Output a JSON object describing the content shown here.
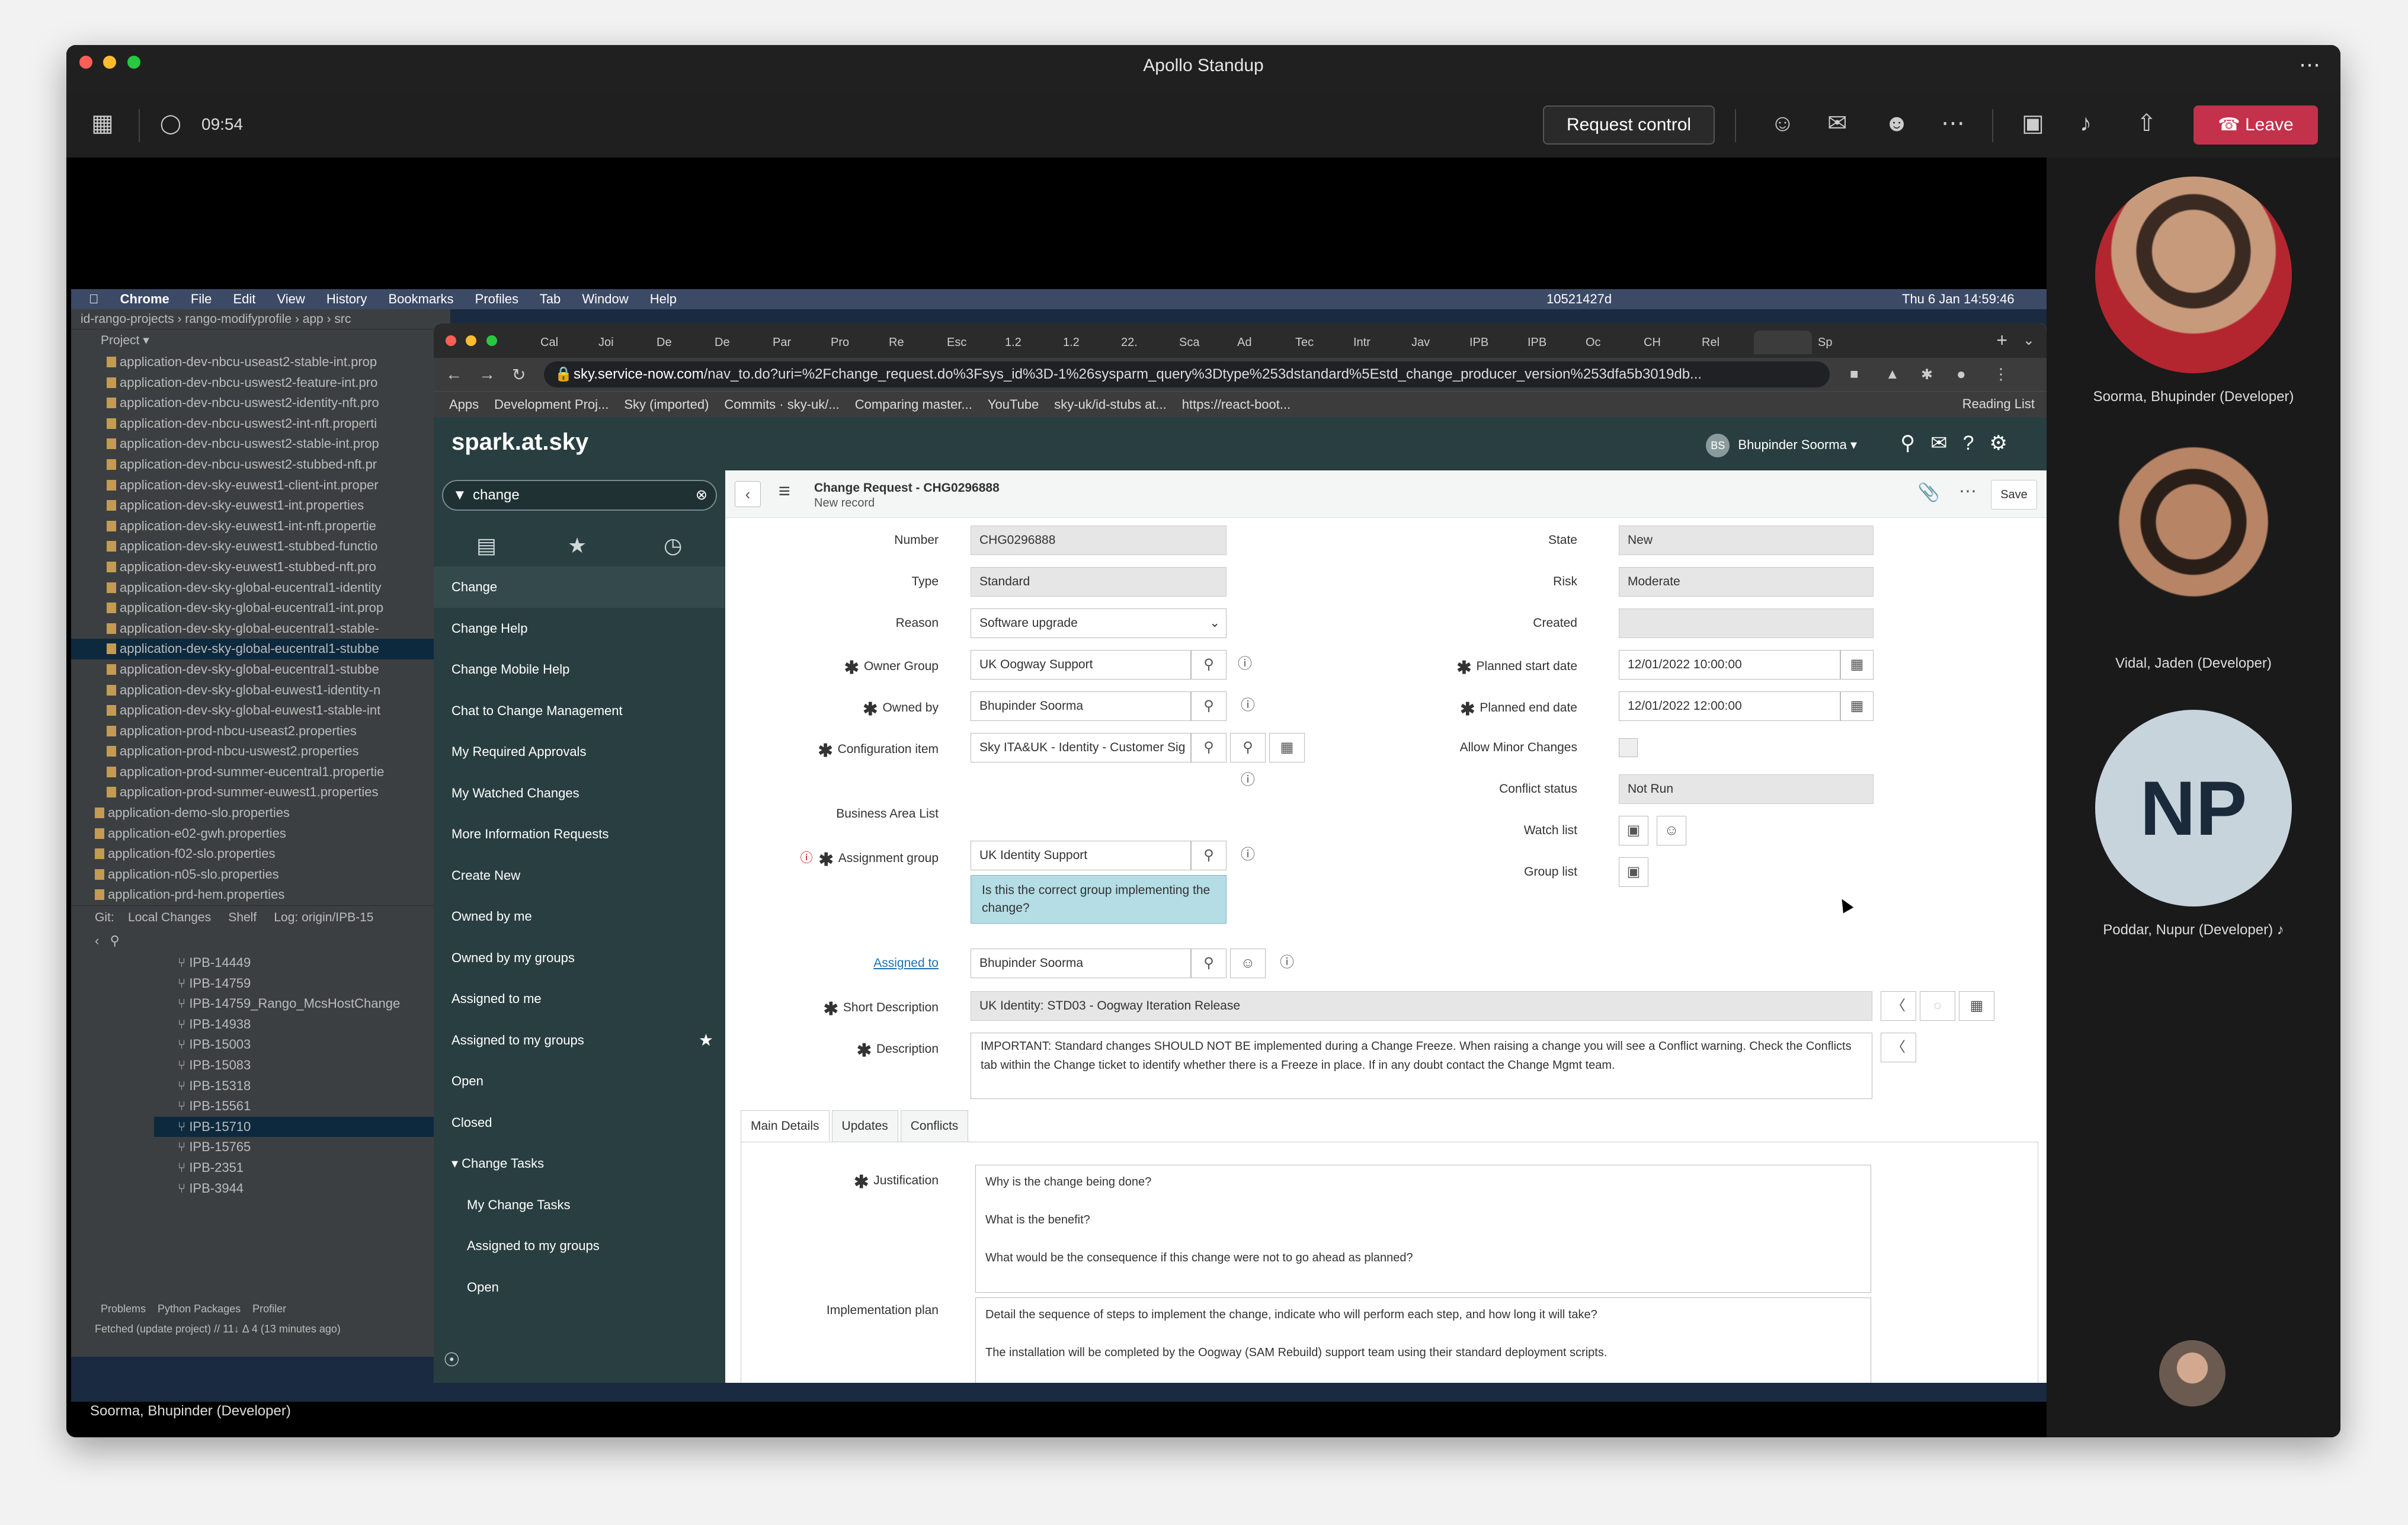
{
  "meeting": {
    "title": "Apollo Standup",
    "timer": "09:54",
    "request_control": "Request control",
    "leave": "Leave",
    "presenter_caption": "Soorma, Bhupinder (Developer)"
  },
  "participants": [
    {
      "name": "Soorma, Bhupinder (Developer)"
    },
    {
      "name": "Vidal, Jaden (Developer)"
    },
    {
      "name": "Poddar, Nupur (Developer)",
      "initials": "NP"
    }
  ],
  "mac_menu": {
    "items": [
      "Chrome",
      "File",
      "Edit",
      "View",
      "History",
      "Bookmarks",
      "Profiles",
      "Tab",
      "Window",
      "Help"
    ],
    "status_number": "10521427d",
    "datetime": "Thu 6 Jan  14:59:46"
  },
  "ide": {
    "breadcrumbs": [
      "id-rango-projects",
      "rango-modifyprofile",
      "app",
      "src"
    ],
    "project_label": "Project",
    "files": [
      "application-dev-nbcu-useast2-stable-int.prop",
      "application-dev-nbcu-uswest2-feature-int.pro",
      "application-dev-nbcu-uswest2-identity-nft.pro",
      "application-dev-nbcu-uswest2-int-nft.properti",
      "application-dev-nbcu-uswest2-stable-int.prop",
      "application-dev-nbcu-uswest2-stubbed-nft.pr",
      "application-dev-sky-euwest1-client-int.proper",
      "application-dev-sky-euwest1-int.properties",
      "application-dev-sky-euwest1-int-nft.propertie",
      "application-dev-sky-euwest1-stubbed-functio",
      "application-dev-sky-euwest1-stubbed-nft.pro",
      "application-dev-sky-global-eucentral1-identity",
      "application-dev-sky-global-eucentral1-int.prop",
      "application-dev-sky-global-eucentral1-stable-",
      "application-dev-sky-global-eucentral1-stubbe",
      "application-dev-sky-global-eucentral1-stubbe",
      "application-dev-sky-global-euwest1-identity-n",
      "application-dev-sky-global-euwest1-stable-int",
      "application-prod-nbcu-useast2.properties",
      "application-prod-nbcu-uswest2.properties",
      "application-prod-summer-eucentral1.propertie",
      "application-prod-summer-euwest1.properties",
      "application-demo-slo.properties",
      "application-e02-gwh.properties",
      "application-f02-slo.properties",
      "application-n05-slo.properties",
      "application-prd-hem.properties"
    ],
    "git_tabs": [
      "Git:",
      "Local Changes",
      "Shelf",
      "Log: origin/IPB-15"
    ],
    "branches": [
      "IPB-14449",
      "IPB-14759",
      "IPB-14759_Rango_McsHostChange",
      "IPB-14938",
      "IPB-15003",
      "IPB-15083",
      "IPB-15318",
      "IPB-15561",
      "IPB-15710",
      "IPB-15765",
      "IPB-2351",
      "IPB-3944"
    ],
    "bottom_tabs": [
      "Problems",
      "Python Packages",
      "Profiler"
    ],
    "status": "Fetched (update project) // 11↓ Δ 4 (13 minutes ago)"
  },
  "browser": {
    "tabs": [
      "Cal",
      "Joi",
      "De",
      "De",
      "Par",
      "Pro",
      "Re",
      "Esc",
      "1.2",
      "1.2",
      "22.",
      "Sca",
      "Ad",
      "Tec",
      "Intr",
      "Jav",
      "IPB",
      "IPB",
      "Oc",
      "CH",
      "Rel",
      "",
      "Sp"
    ],
    "url_host": "sky.service-now.com",
    "url_path": "/nav_to.do?uri=%2Fchange_request.do%3Fsys_id%3D-1%26sysparm_query%3Dtype%253dstandard%5Estd_change_producer_version%253dfa5b3019db...",
    "bookmarks": [
      "Apps",
      "Development Proj...",
      "Sky (imported)",
      "Commits · sky-uk/...",
      "Comparing master...",
      "YouTube",
      "sky-uk/id-stubs at...",
      "https://react-boot..."
    ],
    "reading_list": "Reading List"
  },
  "servicenow": {
    "logo": "spark.at.sky",
    "user_initials": "BS",
    "user_name": "Bhupinder Soorma",
    "filter_value": "change",
    "nav_items": [
      {
        "label": "Change",
        "type": "head"
      },
      {
        "label": "Change Help",
        "type": "item"
      },
      {
        "label": "Change Mobile Help",
        "type": "item"
      },
      {
        "label": "Chat to Change Management",
        "type": "item"
      },
      {
        "label": "My Required Approvals",
        "type": "item"
      },
      {
        "label": "My Watched Changes",
        "type": "item"
      },
      {
        "label": "More Information Requests",
        "type": "item"
      },
      {
        "label": "Create New",
        "type": "item"
      },
      {
        "label": "Owned by me",
        "type": "item"
      },
      {
        "label": "Owned by my groups",
        "type": "item"
      },
      {
        "label": "Assigned to me",
        "type": "item"
      },
      {
        "label": "Assigned to my groups",
        "type": "item"
      },
      {
        "label": "Open",
        "type": "item"
      },
      {
        "label": "Closed",
        "type": "item"
      },
      {
        "label": "Change Tasks",
        "type": "section"
      },
      {
        "label": "My Change Tasks",
        "type": "sub"
      },
      {
        "label": "Assigned to my groups",
        "type": "sub"
      },
      {
        "label": "Open",
        "type": "sub"
      }
    ],
    "form": {
      "title": "Change Request - CHG0296888",
      "subtitle": "New record",
      "save": "Save",
      "labels": {
        "number": "Number",
        "type": "Type",
        "reason": "Reason",
        "owner_group": "Owner Group",
        "owned_by": "Owned by",
        "config_item": "Configuration item",
        "business_area": "Business Area List",
        "assignment_group": "Assignment group",
        "assigned_to": "Assigned to",
        "short_description": "Short Description",
        "description": "Description",
        "state": "State",
        "risk": "Risk",
        "created": "Created",
        "planned_start": "Planned start date",
        "planned_end": "Planned end date",
        "allow_minor": "Allow Minor Changes",
        "conflict_status": "Conflict status",
        "watch_list": "Watch list",
        "group_list": "Group list",
        "justification": "Justification",
        "implementation_plan": "Implementation plan"
      },
      "values": {
        "number": "CHG0296888",
        "type": "Standard",
        "reason": "Software upgrade",
        "owner_group": "UK Oogway Support",
        "owned_by": "Bhupinder Soorma",
        "config_item": "Sky ITA&UK - Identity - Customer Sig",
        "assignment_group": "UK Identity Support",
        "assignment_hint": "Is this the correct group implementing the change?",
        "assigned_to": "Bhupinder Soorma",
        "short_description": "UK Identity: STD03 - Oogway Iteration Release",
        "description": "IMPORTANT: Standard changes SHOULD NOT BE implemented during a Change Freeze. When raising a change you will  see a Conflict warning. Check the Conflicts tab within the Change ticket to identify whether there is a Freeze in place. If in any doubt contact the Change Mgmt team.",
        "state": "New",
        "risk": "Moderate",
        "created": "",
        "planned_start": "12/01/2022 10:00:00",
        "planned_end": "12/01/2022 12:00:00",
        "conflict_status": "Not Run"
      },
      "tabs": [
        "Main Details",
        "Updates",
        "Conflicts"
      ],
      "justification_lines": [
        "Why is the change being done?",
        "",
        "What is the benefit?",
        "",
        "What would be the consequence if this change were not to go ahead as planned?"
      ],
      "implementation_lines": [
        "Detail the sequence of steps to implement the change, indicate who will perform each step, and how long it will take?",
        "",
        "The installation will be completed by the Oogway (SAM Rebuild) support team using their standard deployment scripts."
      ]
    }
  },
  "colors": {
    "teams_leave": "#c4314b",
    "sn_header": "#293e40",
    "ide_bg": "#3c3f41"
  }
}
